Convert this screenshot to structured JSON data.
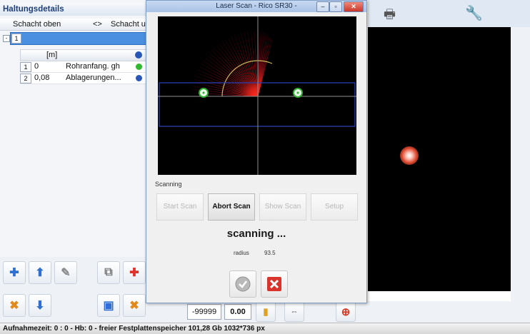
{
  "panel": {
    "title": "Haltungsdetails",
    "columns": {
      "upper": "Schacht oben",
      "arrow": "<>",
      "lower": "Schacht u"
    },
    "main_row_number": "1",
    "expander": "-",
    "sub_columns": {
      "unit": "[m]"
    },
    "sub_rows": [
      {
        "num": "1",
        "value": "0",
        "desc": "Rohranfang. gh",
        "status_color": "#2fb82f"
      },
      {
        "num": "2",
        "value": "0,08",
        "desc": "Ablagerungen...",
        "status_color": "#2857b8"
      }
    ]
  },
  "dialog": {
    "title": "Laser Scan - Rico SR30 -",
    "scanning_label": "Scanning",
    "buttons": {
      "start": "Start Scan",
      "abort": "Abort Scan",
      "show": "Show Scan",
      "setup": "Setup"
    },
    "status": "scanning ...",
    "radius_label": "radius",
    "radius_value": "93.5"
  },
  "bottom_fields": {
    "field_a": "-99999",
    "field_b": "0.00"
  },
  "status_bar": {
    "label": "Aufnahmezeit:",
    "text": "0 : 0 - Hb: 0 - freier Festplattenspeicher 101,28 Gb  1032*736 px"
  },
  "colors": {
    "accent": "#4a8fe0",
    "close": "#d9342b",
    "scan_ring": "#c8b85a"
  }
}
